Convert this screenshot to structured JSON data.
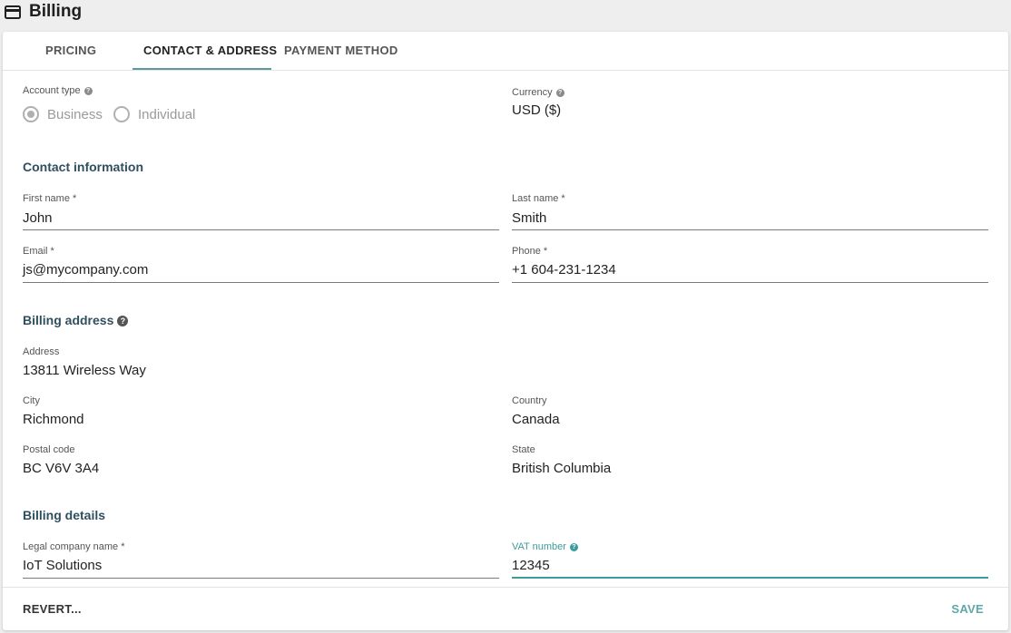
{
  "header": {
    "title": "Billing",
    "icon": "credit-card-icon"
  },
  "tabs": [
    {
      "label": "PRICING",
      "active": false
    },
    {
      "label": "CONTACT & ADDRESS",
      "active": true
    },
    {
      "label": "PAYMENT METHOD",
      "active": false
    }
  ],
  "account": {
    "label": "Account type",
    "options": [
      {
        "label": "Business",
        "checked": true
      },
      {
        "label": "Individual",
        "checked": false
      }
    ]
  },
  "currency": {
    "label": "Currency",
    "value": "USD ($)"
  },
  "contact": {
    "heading": "Contact information",
    "first_name": {
      "label": "First name *",
      "value": "John"
    },
    "last_name": {
      "label": "Last name *",
      "value": "Smith"
    },
    "email": {
      "label": "Email *",
      "value": "js@mycompany.com"
    },
    "phone": {
      "label": "Phone *",
      "value": "+1 604-231-1234"
    }
  },
  "billing_address": {
    "heading": "Billing address",
    "address": {
      "label": "Address",
      "value": "13811 Wireless Way"
    },
    "city": {
      "label": "City",
      "value": "Richmond"
    },
    "country": {
      "label": "Country",
      "value": "Canada"
    },
    "postal_code": {
      "label": "Postal code",
      "value": "BC V6V 3A4"
    },
    "state": {
      "label": "State",
      "value": "British Columbia"
    }
  },
  "billing_details": {
    "heading": "Billing details",
    "company": {
      "label": "Legal company name *",
      "value": "IoT Solutions"
    },
    "vat": {
      "label": "VAT number",
      "value": "12345"
    }
  },
  "footer": {
    "revert_label": "REVERT...",
    "save_label": "SAVE"
  },
  "colors": {
    "accent": "#3b9c9c",
    "section_heading": "#2f4f5f"
  }
}
